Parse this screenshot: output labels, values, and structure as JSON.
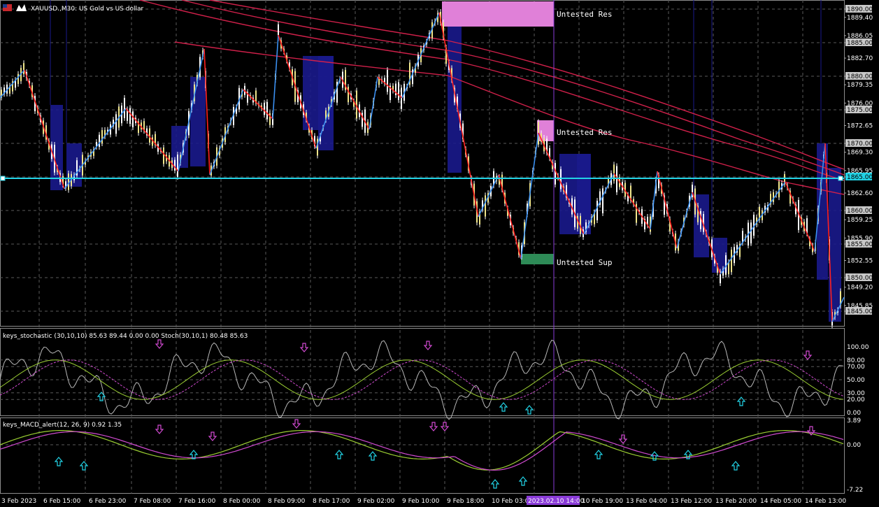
{
  "header": {
    "symbol_title": "XAUUSD.,M30: US Gold vs US dollar"
  },
  "price_axis": {
    "labels": [
      "1890.00",
      "1889.40",
      "1886.05",
      "1885.00",
      "1882.70",
      "1880.00",
      "1879.35",
      "1876.00",
      "1875.00",
      "1872.65",
      "1870.00",
      "1869.30",
      "1865.95",
      "1865.00",
      "1862.60",
      "1860.00",
      "1859.25",
      "1855.90",
      "1855.00",
      "1852.55",
      "1850.00",
      "1849.20",
      "1845.85",
      "1845.00"
    ],
    "boxed": [
      "1890.00",
      "1885.00",
      "1880.00",
      "1875.00",
      "1870.00",
      "1865.00",
      "1860.00",
      "1855.00",
      "1850.00",
      "1845.00"
    ]
  },
  "zones": {
    "res_top": "Untested Res",
    "res_mid": "Untested Res",
    "sup": "Untested Sup"
  },
  "stoch": {
    "title": "keys_stochastic (30,10,10) 85.63 89.44 0.00 0.00 Stoch(30,10,1) 80.48 85.63",
    "levels": [
      "100.00",
      "80.00",
      "70.00",
      "50.00",
      "30.00",
      "20.00",
      "0.00"
    ]
  },
  "macd": {
    "title": "keys_MACD_alert(12, 26, 9) 0.92 1.35",
    "levels": [
      "3.89",
      "0.00",
      "-7.22"
    ]
  },
  "time_axis": {
    "labels": [
      "3 Feb 2023",
      "6 Feb 15:00",
      "6 Feb 23:00",
      "7 Feb 08:00",
      "7 Feb 16:00",
      "8 Feb 00:00",
      "8 Feb 09:00",
      "8 Feb 17:00",
      "9 Feb 02:00",
      "9 Feb 10:00",
      "9 Feb 18:00",
      "10 Feb 03:00",
      "2023.02.10 14:00",
      "10 Feb 19:00",
      "13 Feb 04:00",
      "13 Feb 12:00",
      "13 Feb 20:00",
      "14 Feb 05:00",
      "14 Feb 13:00"
    ]
  },
  "colors": {
    "background": "#000000",
    "grid": "#5a5a5a",
    "current_price_line": "#22d3e6",
    "zigzag_up": "#3a8ff0",
    "zigzag_down": "#ff2020",
    "moving_average": "#d0204a",
    "res_zone": "#e080d8",
    "sup_zone": "#2e8b57",
    "block": "#1a1a8c",
    "crosshair": "#8a3bd8"
  }
}
